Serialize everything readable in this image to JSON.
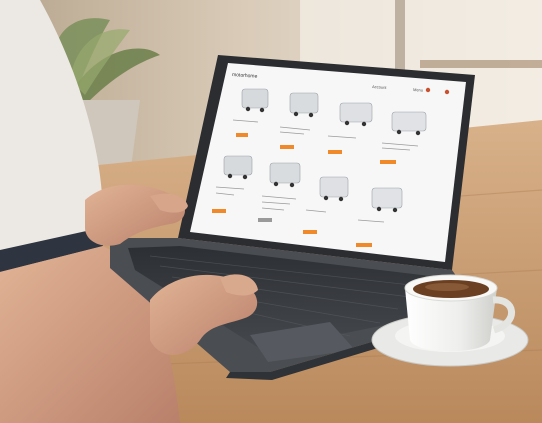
{
  "photo": {
    "subject": "person browsing a motorhome rental website on a laptop next to a coffee cup"
  },
  "website": {
    "logo_text": "motorhome",
    "header_links": [
      "Account",
      "Menu"
    ],
    "listings": [
      {
        "vehicle": "camper-van",
        "has_button": true
      },
      {
        "vehicle": "camper-van",
        "has_button": true
      },
      {
        "vehicle": "motorhome",
        "has_button": true
      },
      {
        "vehicle": "motorhome",
        "has_button": true
      },
      {
        "vehicle": "motorhome",
        "has_button": true
      },
      {
        "vehicle": "motorhome",
        "has_button": true
      },
      {
        "vehicle": "camper-van",
        "has_button": true
      },
      {
        "vehicle": "motorhome",
        "has_button": true
      }
    ],
    "button_color": "#f0892a"
  },
  "colors": {
    "wood_table": "#c89a6a",
    "laptop_body": "#3a3d42",
    "screen_bg": "#f7f7f7",
    "accent_orange": "#f0892a",
    "cup": "#f4f4f2",
    "coffee": "#6b3f22",
    "sleeve": "#e9e6e1",
    "skin": "#d49f80"
  }
}
